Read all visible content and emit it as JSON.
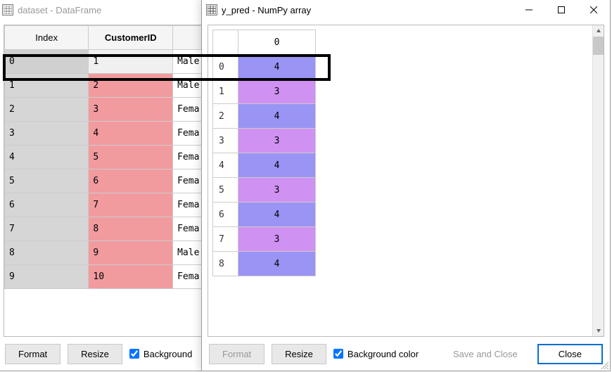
{
  "back_window": {
    "title": "dataset - DataFrame",
    "columns": {
      "index": "Index",
      "customer_id": "CustomerID"
    },
    "rows": [
      {
        "index": "0",
        "id": "1",
        "gender": "Male"
      },
      {
        "index": "1",
        "id": "2",
        "gender": "Male"
      },
      {
        "index": "2",
        "id": "3",
        "gender": "Fema"
      },
      {
        "index": "3",
        "id": "4",
        "gender": "Fema"
      },
      {
        "index": "4",
        "id": "5",
        "gender": "Fema"
      },
      {
        "index": "5",
        "id": "6",
        "gender": "Fema"
      },
      {
        "index": "6",
        "id": "7",
        "gender": "Fema"
      },
      {
        "index": "7",
        "id": "8",
        "gender": "Fema"
      },
      {
        "index": "8",
        "id": "9",
        "gender": "Male"
      },
      {
        "index": "9",
        "id": "10",
        "gender": "Fema"
      }
    ],
    "cid_color": "#f19b9f",
    "toolbar": {
      "format": "Format",
      "resize": "Resize",
      "bgcolor": "Background"
    }
  },
  "front_window": {
    "title": "y_pred - NumPy array",
    "header_value": "0",
    "rows": [
      {
        "index": "0",
        "val": "4",
        "color": "#9a94f4"
      },
      {
        "index": "1",
        "val": "3",
        "color": "#cf91f2"
      },
      {
        "index": "2",
        "val": "4",
        "color": "#9a94f4"
      },
      {
        "index": "3",
        "val": "3",
        "color": "#cf91f2"
      },
      {
        "index": "4",
        "val": "4",
        "color": "#9a94f4"
      },
      {
        "index": "5",
        "val": "3",
        "color": "#cf91f2"
      },
      {
        "index": "6",
        "val": "4",
        "color": "#9a94f4"
      },
      {
        "index": "7",
        "val": "3",
        "color": "#cf91f2"
      },
      {
        "index": "8",
        "val": "4",
        "color": "#9a94f4"
      }
    ],
    "toolbar": {
      "format": "Format",
      "resize": "Resize",
      "bgcolor": "Background color"
    },
    "footer": {
      "save_close": "Save and Close",
      "close": "Close"
    }
  }
}
